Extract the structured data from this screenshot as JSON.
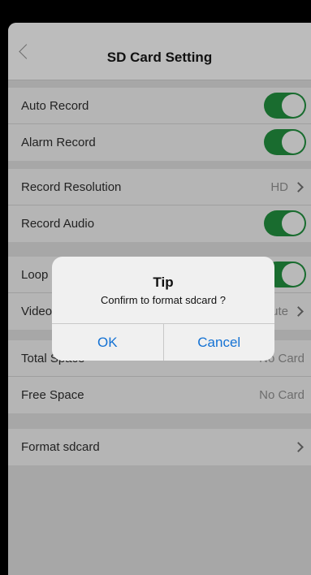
{
  "nav": {
    "title": "SD Card Setting"
  },
  "settings": {
    "auto_record": {
      "label": "Auto Record",
      "on": true
    },
    "alarm_record": {
      "label": "Alarm Record",
      "on": true
    },
    "record_resolution": {
      "label": "Record Resolution",
      "value": "HD"
    },
    "record_audio": {
      "label": "Record Audio",
      "on": true
    },
    "loop": {
      "label": "Loop",
      "on": true
    },
    "video": {
      "label": "Video",
      "value": "ute"
    },
    "total_space": {
      "label": "Total Space",
      "value": "No Card"
    },
    "free_space": {
      "label": "Free Space",
      "value": "No Card"
    },
    "format": {
      "label": "Format sdcard"
    }
  },
  "dialog": {
    "title": "Tip",
    "message": "Confirm to format sdcard ?",
    "ok_label": "OK",
    "cancel_label": "Cancel"
  },
  "colors": {
    "toggle_on": "#196c2f",
    "link_blue": "#1472d4"
  }
}
